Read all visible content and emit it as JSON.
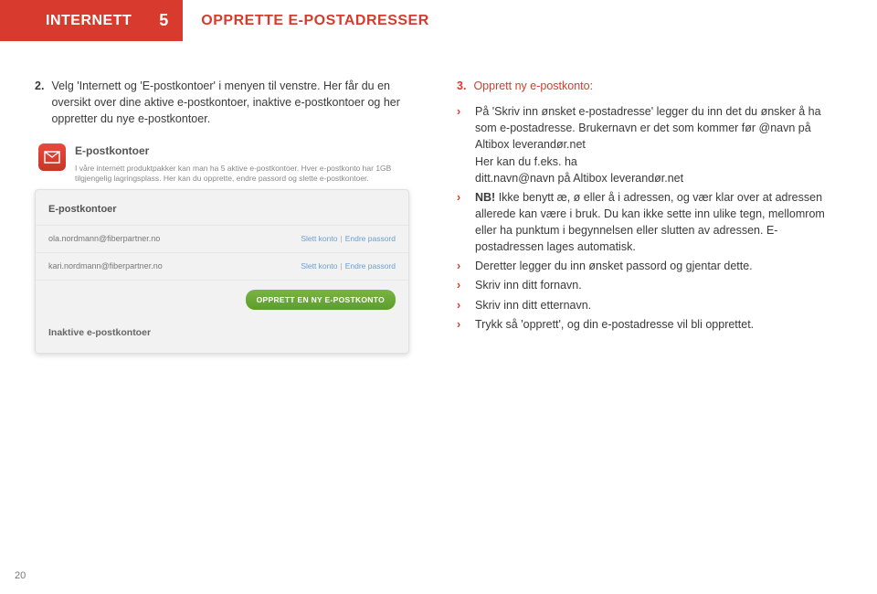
{
  "header": {
    "section": "INTERNETT",
    "chapter_num": "5",
    "title": "OPPRETTE E-POSTADRESSER"
  },
  "left": {
    "step_num": "2.",
    "step_text": "Velg 'Internett og 'E-postkontoer' i menyen til venstre. Her får du en oversikt over dine aktive e-postkontoer, inaktive e-postkontoer og her oppretter du nye e-postkontoer."
  },
  "app": {
    "heading": "E-postkontoer",
    "desc": "I våre internett produktpakker kan man ha 5 aktive e-postkontoer. Hver e-postkonto har 1GB tilgjengelig lagringsplass. Her kan du opprette, endre passord og slette e-postkontoer.",
    "panel_title": "E-postkontoer",
    "rows": [
      {
        "email": "ola.nordmann@fiberpartner.no",
        "link1": "Slett konto",
        "link2": "Endre passord"
      },
      {
        "email": "kari.nordmann@fiberpartner.no",
        "link1": "Slett konto",
        "link2": "Endre passord"
      }
    ],
    "button": "OPPRETT EN NY E-POSTKONTO",
    "inactive": "Inaktive e-postkontoer"
  },
  "right": {
    "step_num": "3.",
    "step_title": "Opprett ny e-postkonto:",
    "bullets": [
      "På 'Skriv inn ønsket e-postadresse' legger du inn det du ønsker å ha som e-postadresse. Brukernavn er det som kommer før @navn på Altibox leverandør.net\nHer kan du f.eks. ha\nditt.navn@navn på Altibox leverandør.net",
      "<strong>NB!</strong> Ikke benytt æ, ø eller å i adressen, og vær klar over at adressen allerede kan være i bruk. Du kan ikke sette inn ulike tegn, mellomrom eller ha punktum i begynnelsen eller slutten av adressen. E-postadressen lages automatisk.",
      "Deretter legger du inn ønsket passord og gjentar dette.",
      "Skriv inn ditt fornavn.",
      "Skriv inn ditt etternavn.",
      "Trykk så 'opprett', og din e-postadresse vil bli opprettet."
    ]
  },
  "page_num": "20"
}
